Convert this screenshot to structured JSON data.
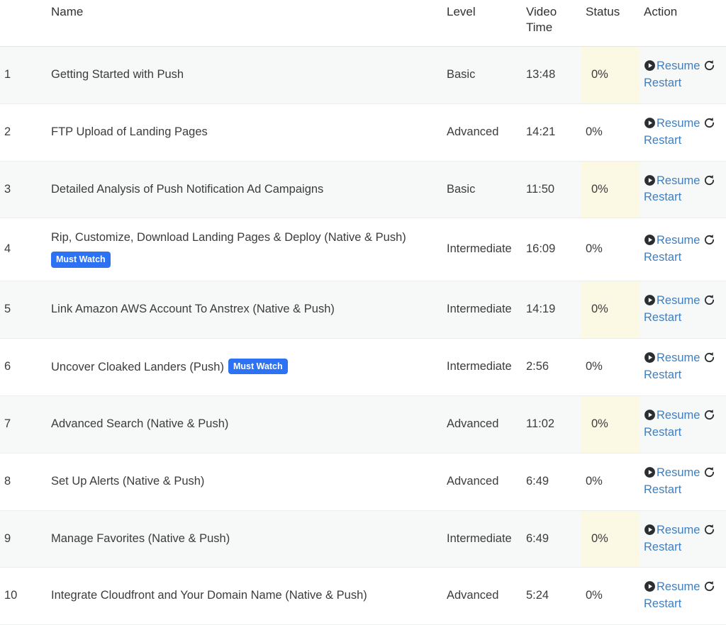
{
  "table": {
    "columns": {
      "number": "",
      "name": "Name",
      "level": "Level",
      "video_time": "Video Time",
      "video_time_line1": "Video",
      "video_time_line2": "Time",
      "status": "Status",
      "action": "Action"
    },
    "action_labels": {
      "resume": "Resume",
      "restart": "Restart"
    },
    "badge_label": "Must Watch",
    "accent_link_color": "#3e7fc1",
    "badge_color": "#2d72f3",
    "status_cell_color": "#fbf8e3",
    "stripe_color": "#f7f8f8",
    "rows": [
      {
        "num": "1",
        "name": "Getting Started with Push",
        "badge": null,
        "badge_position": "none",
        "level": "Basic",
        "time": "13:48",
        "status": "0%"
      },
      {
        "num": "2",
        "name": "FTP Upload of Landing Pages",
        "badge": null,
        "badge_position": "none",
        "level": "Advanced",
        "time": "14:21",
        "status": "0%"
      },
      {
        "num": "3",
        "name": "Detailed Analysis of Push Notification Ad Campaigns",
        "badge": null,
        "badge_position": "none",
        "level": "Basic",
        "time": "11:50",
        "status": "0%"
      },
      {
        "num": "4",
        "name": "Rip, Customize, Download Landing Pages & Deploy (Native & Push)",
        "badge": "Must Watch",
        "badge_position": "block",
        "level": "Intermediate",
        "time": "16:09",
        "status": "0%"
      },
      {
        "num": "5",
        "name": "Link Amazon AWS Account To Anstrex (Native & Push)",
        "badge": null,
        "badge_position": "none",
        "level": "Intermediate",
        "time": "14:19",
        "status": "0%"
      },
      {
        "num": "6",
        "name": "Uncover Cloaked Landers (Push)",
        "badge": "Must Watch",
        "badge_position": "inline",
        "level": "Intermediate",
        "time": "2:56",
        "status": "0%"
      },
      {
        "num": "7",
        "name": "Advanced Search (Native & Push)",
        "badge": null,
        "badge_position": "none",
        "level": "Advanced",
        "time": "11:02",
        "status": "0%"
      },
      {
        "num": "8",
        "name": "Set Up Alerts (Native & Push)",
        "badge": null,
        "badge_position": "none",
        "level": "Advanced",
        "time": "6:49",
        "status": "0%"
      },
      {
        "num": "9",
        "name": "Manage Favorites (Native & Push)",
        "badge": null,
        "badge_position": "none",
        "level": "Intermediate",
        "time": "6:49",
        "status": "0%"
      },
      {
        "num": "10",
        "name": "Integrate Cloudfront and Your Domain Name (Native & Push)",
        "badge": null,
        "badge_position": "none",
        "level": "Advanced",
        "time": "5:24",
        "status": "0%"
      }
    ]
  }
}
